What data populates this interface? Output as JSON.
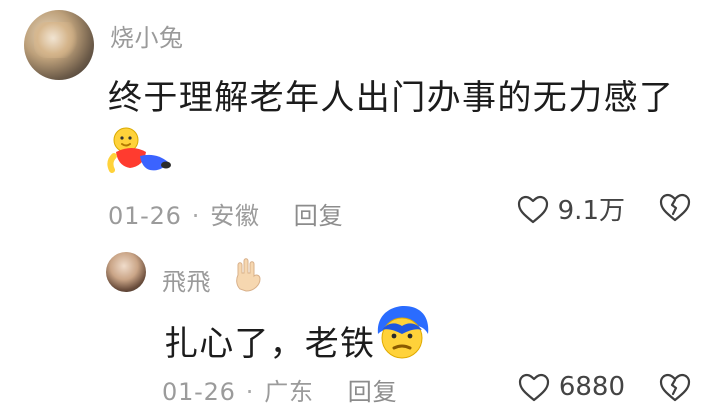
{
  "comment": {
    "username": "烧小兔",
    "text": "终于理解老年人出门办事的无力感了",
    "sticker_icon": "person-lying-down-sticker",
    "meta": {
      "date": "01-26",
      "location": "安徽",
      "reply_label": "回复"
    },
    "likes": "9.1万"
  },
  "reply": {
    "username": "飛飛",
    "username_emoji_icon": "rock-on-hand-emoji",
    "text": "扎心了，老铁",
    "text_emoji_icon": "blue-hair-face-emoji",
    "meta": {
      "date": "01-26",
      "location": "广东",
      "reply_label": "回复"
    },
    "likes": "6880"
  },
  "colors": {
    "meta_text": "#9b9b9b",
    "name_text": "#9a9a9a",
    "comment_text": "#1c1c1c",
    "icon_stroke": "#3f3f3f"
  }
}
